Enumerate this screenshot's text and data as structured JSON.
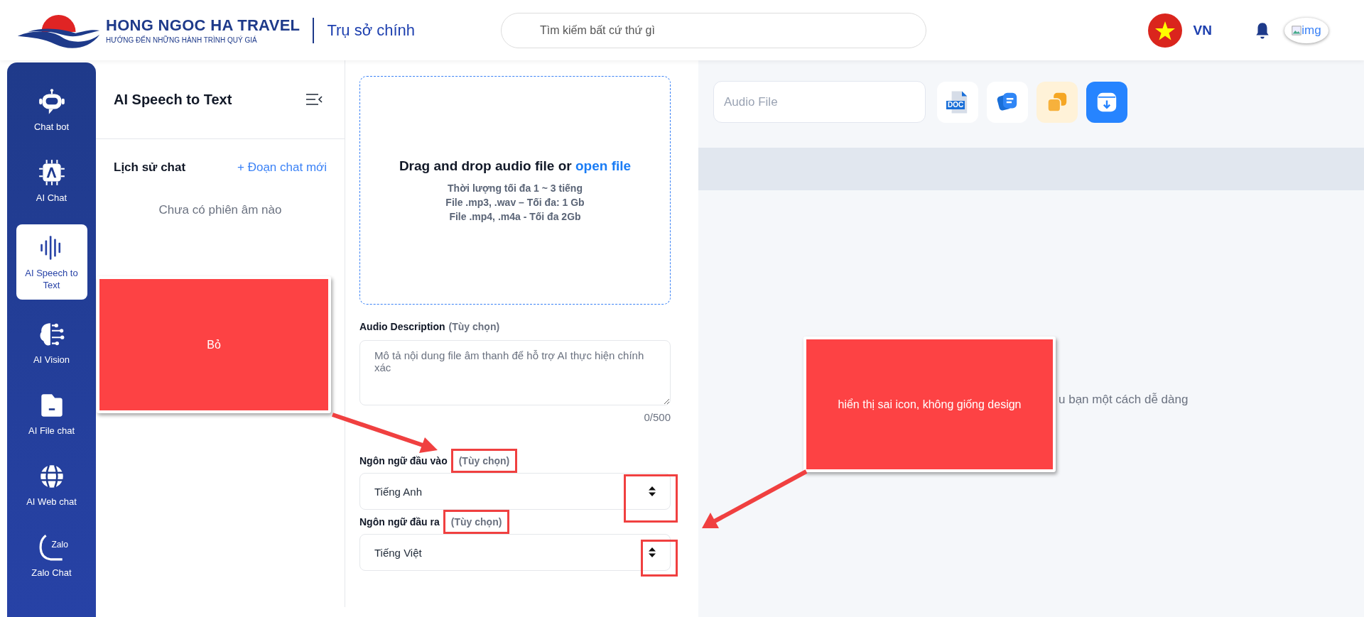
{
  "header": {
    "brand": "HONG NGOC HA TRAVEL",
    "slogan": "HƯỚNG ĐẾN NHỮNG HÀNH TRÌNH QUÝ GIÁ",
    "branch": "Trụ sở chính",
    "search": {
      "placeholder": "Tìm kiếm bất cứ thứ gì"
    },
    "language": "VN",
    "avatar_alt": "img"
  },
  "sidebar": {
    "items": [
      {
        "kind": "bot",
        "label": "Chat bot",
        "selected": false
      },
      {
        "kind": "chip",
        "label": "AI Chat",
        "selected": false
      },
      {
        "kind": "wave",
        "label": "AI Speech to Text",
        "selected": true
      },
      {
        "kind": "brain",
        "label": "AI Vision",
        "selected": false
      },
      {
        "kind": "folder",
        "label": "AI File chat",
        "selected": false
      },
      {
        "kind": "globe",
        "label": "AI Web chat",
        "selected": false
      },
      {
        "kind": "zalo",
        "label": "Zalo Chat",
        "selected": false,
        "glyph": "Zalo"
      }
    ]
  },
  "history": {
    "title": "AI Speech to Text",
    "heading": "Lịch sử chat",
    "new_chat": "+ Đoạn chat mới",
    "empty": "Chưa có phiên âm nào"
  },
  "upload": {
    "prompt": "Drag and drop audio file or",
    "link": "open file",
    "notes": [
      "Thời lượng tối đa 1 ~ 3 tiếng",
      "File .mp3, .wav – Tối đa: 1 Gb",
      "File .mp4, .m4a - Tối đa 2Gb"
    ]
  },
  "description": {
    "label": "Audio Description",
    "hint": "(Tùy chọn)",
    "placeholder": "Mô tả nội dung file âm thanh để hỗ trợ AI thực hiện chính xác",
    "counter": "0/500"
  },
  "languages": [
    {
      "label": "Ngôn ngữ đầu vào",
      "hint": "(Tùy chọn)",
      "hint_marked": true,
      "value": "Tiếng Anh",
      "arrow_marked": true
    },
    {
      "label": "Ngôn ngữ đầu ra",
      "hint": "(Tùy chọn)",
      "hint_marked": true,
      "value": "Tiếng Việt",
      "arrow_marked": true
    }
  ],
  "result": {
    "file": {
      "placeholder": "Audio File"
    },
    "tools": [
      {
        "kind": "doc",
        "glyph": "DOC"
      },
      {
        "kind": "chat"
      },
      {
        "kind": "copy"
      },
      {
        "kind": "download"
      }
    ],
    "message": "u bạn một cách dễ dàng"
  },
  "annotations": [
    {
      "text": "Bỏ",
      "kind": "left"
    },
    {
      "text": "hiển thị sai icon, không giống design",
      "kind": "right"
    }
  ]
}
